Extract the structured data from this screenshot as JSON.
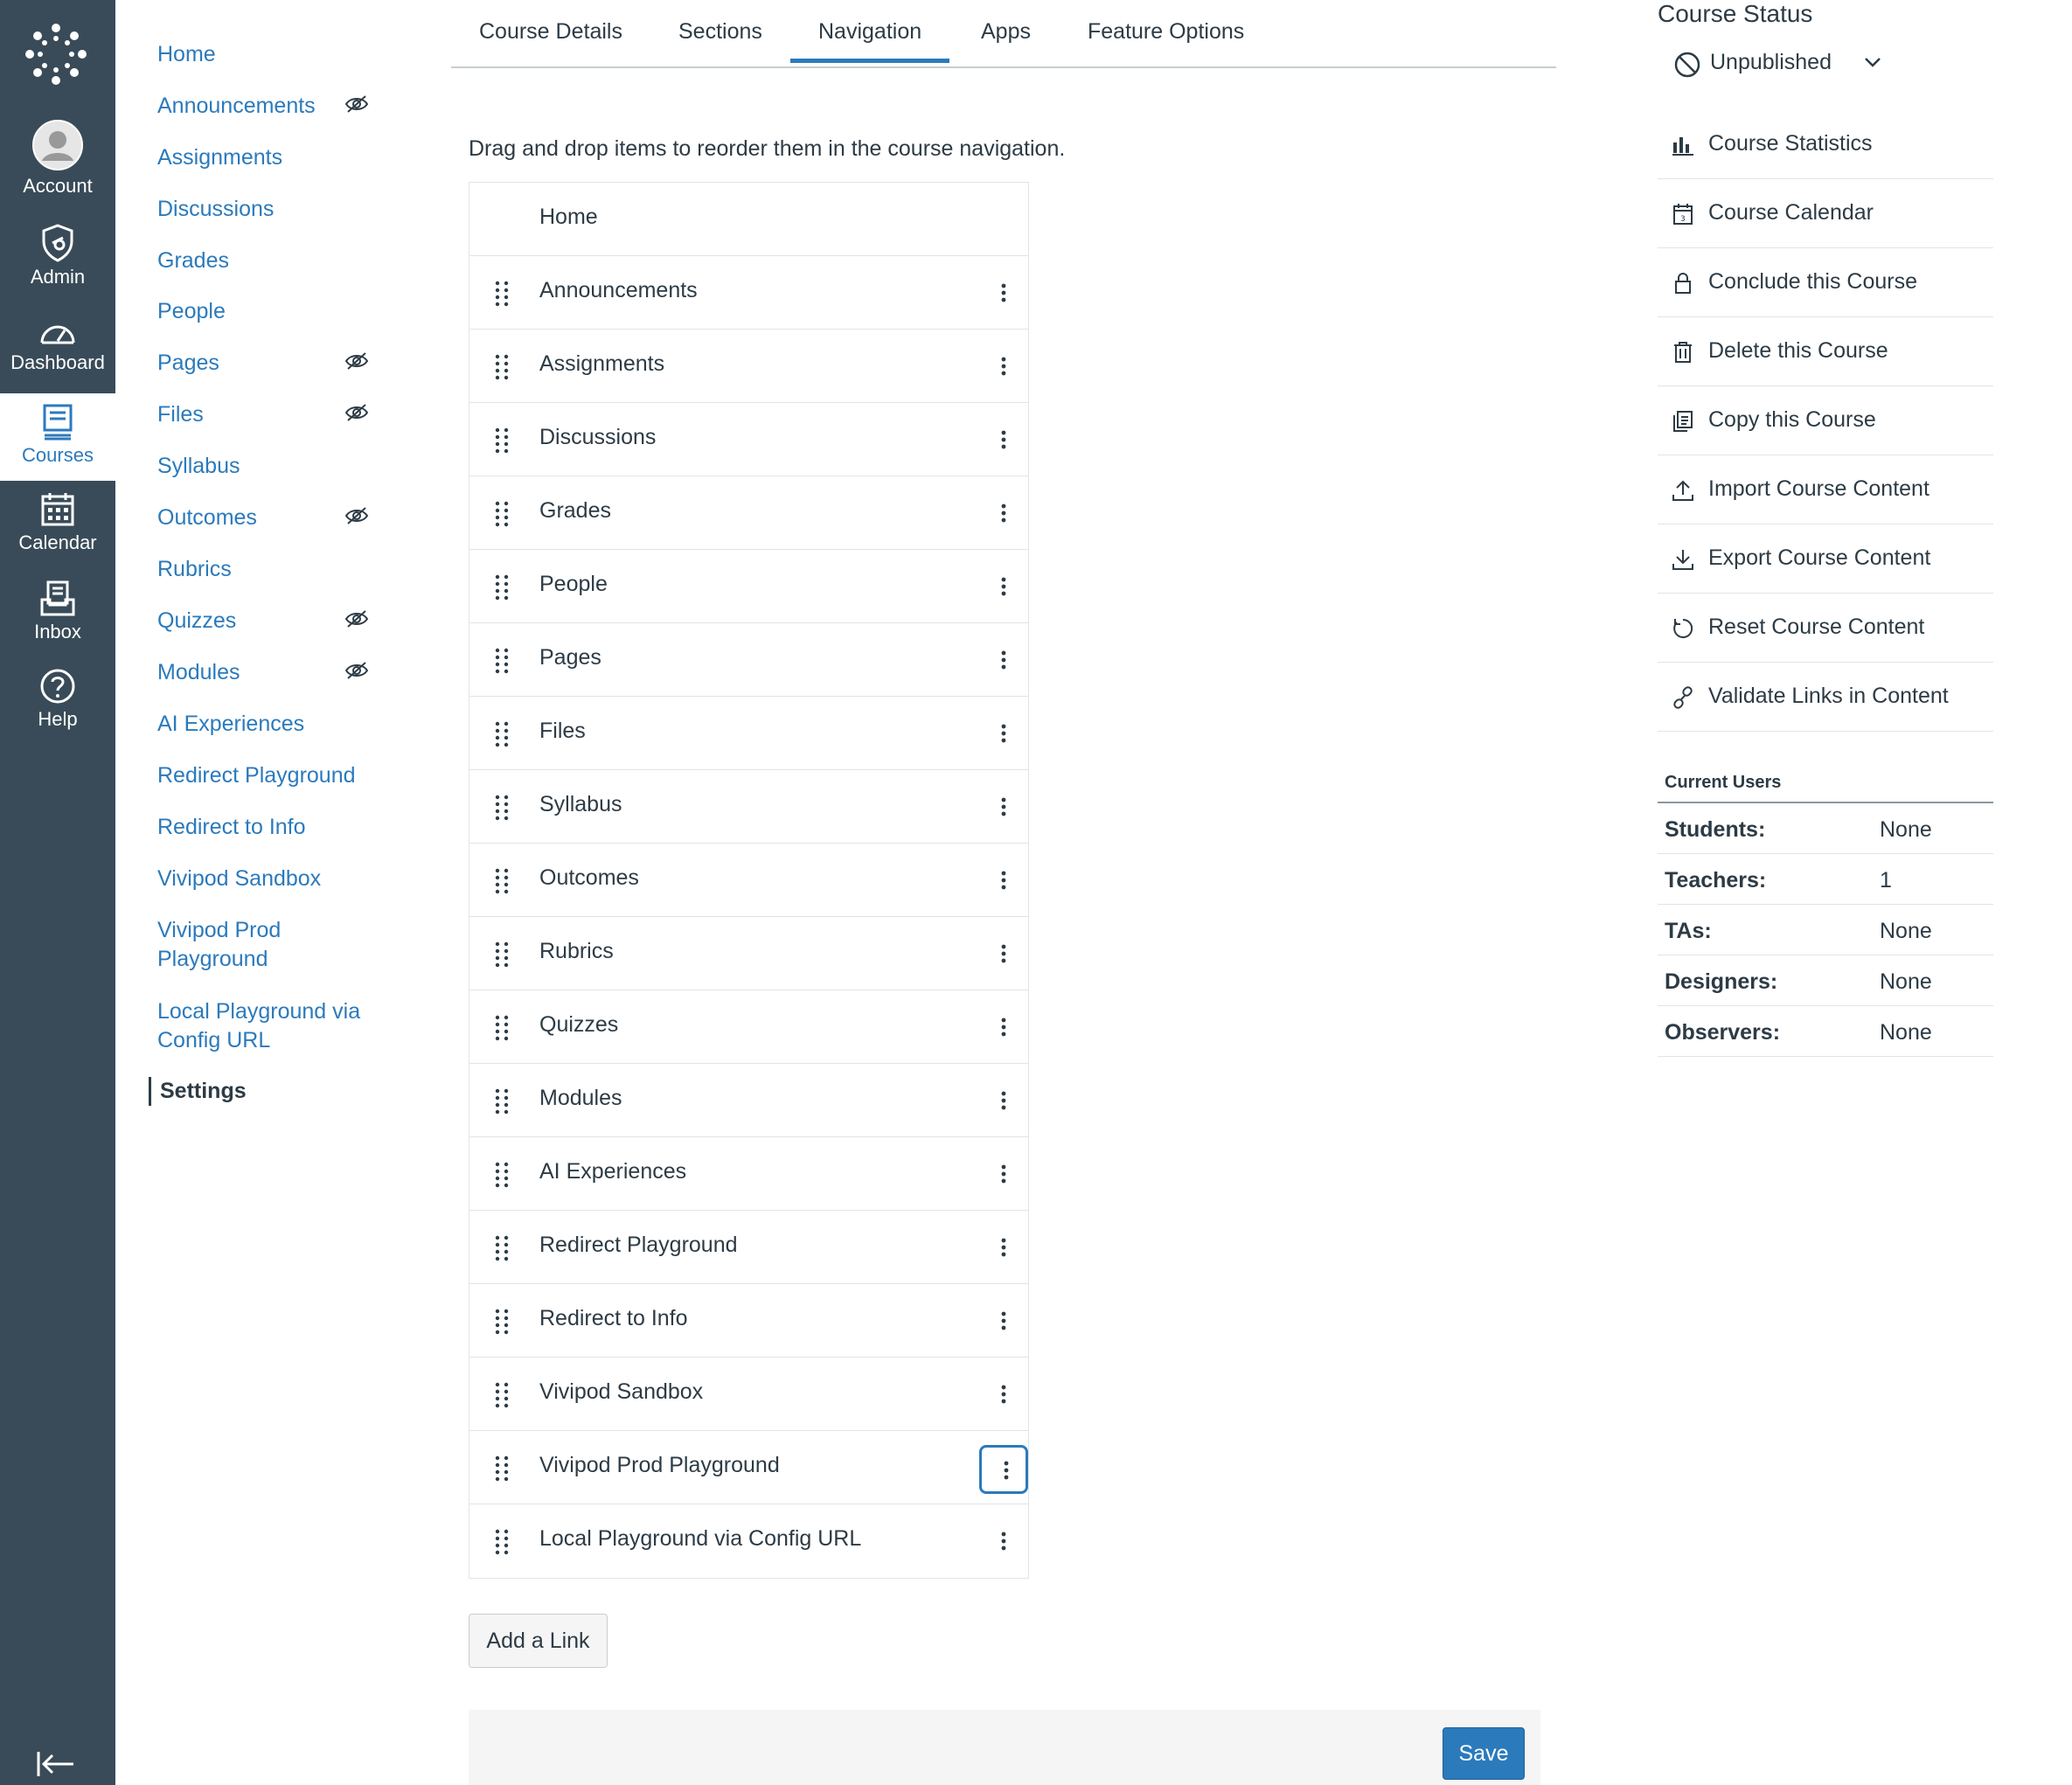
{
  "global_nav": {
    "items": [
      {
        "label": "Account",
        "icon": "avatar-icon"
      },
      {
        "label": "Admin",
        "icon": "shield-icon"
      },
      {
        "label": "Dashboard",
        "icon": "dashboard-icon"
      },
      {
        "label": "Courses",
        "icon": "courses-icon"
      },
      {
        "label": "Calendar",
        "icon": "calendar-icon"
      },
      {
        "label": "Inbox",
        "icon": "inbox-icon"
      },
      {
        "label": "Help",
        "icon": "help-icon"
      }
    ],
    "active": "Courses",
    "colors": {
      "background": "#394b58",
      "active_text": "#2b7abc"
    }
  },
  "course_nav": {
    "items": [
      {
        "label": "Home",
        "hidden": false
      },
      {
        "label": "Announcements",
        "hidden": true
      },
      {
        "label": "Assignments",
        "hidden": false
      },
      {
        "label": "Discussions",
        "hidden": false
      },
      {
        "label": "Grades",
        "hidden": false
      },
      {
        "label": "People",
        "hidden": false
      },
      {
        "label": "Pages",
        "hidden": true
      },
      {
        "label": "Files",
        "hidden": true
      },
      {
        "label": "Syllabus",
        "hidden": false
      },
      {
        "label": "Outcomes",
        "hidden": true
      },
      {
        "label": "Rubrics",
        "hidden": false
      },
      {
        "label": "Quizzes",
        "hidden": true
      },
      {
        "label": "Modules",
        "hidden": true
      },
      {
        "label": "AI Experiences",
        "hidden": false
      },
      {
        "label": "Redirect Playground",
        "hidden": false
      },
      {
        "label": "Redirect to Info",
        "hidden": false
      },
      {
        "label": "Vivipod Sandbox",
        "hidden": false
      },
      {
        "label": "Vivipod Prod\nPlayground",
        "hidden": false
      },
      {
        "label": "Local Playground via\nConfig URL",
        "hidden": false
      },
      {
        "label": "Settings",
        "hidden": false
      }
    ],
    "active": "Settings",
    "link_color": "#2b7abc"
  },
  "tabs": [
    {
      "label": "Course Details"
    },
    {
      "label": "Sections"
    },
    {
      "label": "Navigation"
    },
    {
      "label": "Apps"
    },
    {
      "label": "Feature Options"
    }
  ],
  "active_tab": "Navigation",
  "navigation": {
    "instructions": "Drag and drop items to reorder them in the course navigation.",
    "items": [
      "Home",
      "Announcements",
      "Assignments",
      "Discussions",
      "Grades",
      "People",
      "Pages",
      "Files",
      "Syllabus",
      "Outcomes",
      "Rubrics",
      "Quizzes",
      "Modules",
      "AI Experiences",
      "Redirect Playground",
      "Redirect to Info",
      "Vivipod Sandbox",
      "Vivipod Prod Playground",
      "Local Playground via Config URL"
    ],
    "focused_item": "Vivipod Prod Playground",
    "add_link_label": "Add a Link",
    "save_label": "Save"
  },
  "sidebar": {
    "status_heading": "Course Status",
    "status_value": "Unpublished",
    "actions": [
      {
        "label": "Course Statistics",
        "icon": "bar-chart-icon"
      },
      {
        "label": "Course Calendar",
        "icon": "calendar-icon"
      },
      {
        "label": "Conclude this Course",
        "icon": "lock-icon"
      },
      {
        "label": "Delete this Course",
        "icon": "trash-icon"
      },
      {
        "label": "Copy this Course",
        "icon": "copy-icon"
      },
      {
        "label": "Import Course Content",
        "icon": "upload-icon"
      },
      {
        "label": "Export Course Content",
        "icon": "download-icon"
      },
      {
        "label": "Reset Course Content",
        "icon": "reset-icon"
      },
      {
        "label": "Validate Links in Content",
        "icon": "link-icon"
      }
    ],
    "current_users_heading": "Current Users",
    "users": [
      {
        "role": "Students:",
        "count": "None"
      },
      {
        "role": "Teachers:",
        "count": "1"
      },
      {
        "role": "TAs:",
        "count": "None"
      },
      {
        "role": "Designers:",
        "count": "None"
      },
      {
        "role": "Observers:",
        "count": "None"
      }
    ]
  },
  "colors": {
    "primary": "#2b7abc",
    "text": "#2d3b45",
    "border": "#e0e4e7",
    "footer": "#f5f5f5"
  }
}
